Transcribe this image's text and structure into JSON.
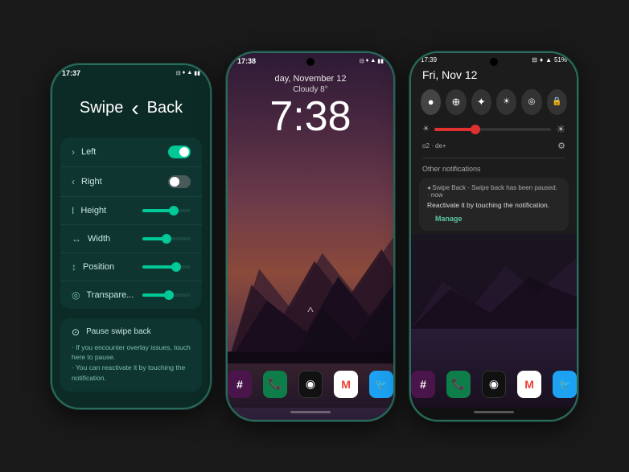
{
  "phone1": {
    "status_bar": {
      "time": "17:37",
      "icons": "⊟ ♦ ▲ ◀ ▮▮"
    },
    "header": {
      "swipe_label": "Swipe",
      "chevron": "‹",
      "back_label": "Back"
    },
    "settings": [
      {
        "icon": "›",
        "label": "Left",
        "control": "toggle_on"
      },
      {
        "icon": "‹",
        "label": "Right",
        "control": "toggle_off"
      },
      {
        "icon": "I",
        "label": "Height",
        "control": "slider",
        "fill": 65
      },
      {
        "icon": "↔",
        "label": "Width",
        "control": "slider",
        "fill": 50
      },
      {
        "icon": "↕",
        "label": "Position",
        "control": "slider",
        "fill": 70
      },
      {
        "icon": "◎",
        "label": "Transpare...",
        "control": "slider",
        "fill": 55
      }
    ],
    "pause_section": {
      "icon": "⊙",
      "label": "Pause swipe back",
      "note1": "· If you encounter overlay issues, touch",
      "note2": "here to pause.",
      "note3": "· You can reactivate it by touching the",
      "note4": "notification."
    }
  },
  "phone2": {
    "status_bar": {
      "time": "17:38",
      "icons": "⊟ ♦ ▲ ◀ ▮▮"
    },
    "date": "day, November 12",
    "weather": "Cloudy 8°",
    "time": "7:38",
    "dock_apps": [
      {
        "name": "Slack",
        "color": "#4a154b",
        "icon": "#"
      },
      {
        "name": "Phone",
        "color": "#0d7d4a",
        "icon": "📞"
      },
      {
        "name": "Camera",
        "color": "#111",
        "icon": "◉"
      },
      {
        "name": "Gmail",
        "color": "#fff",
        "icon": "M"
      },
      {
        "name": "Twitter",
        "color": "#1da1f2",
        "icon": "🐦"
      }
    ]
  },
  "phone3": {
    "status_bar": {
      "time": "17:39",
      "battery": "51%",
      "icons": "⊟ ♦ ▲ ▮"
    },
    "date": "Fri, Nov 12",
    "quick_toggles": [
      "●",
      "⊕",
      "✦",
      "☀",
      "◎",
      "🔒"
    ],
    "brightness": 35,
    "network": "o2 · de+",
    "other_notifications_label": "Other notifications",
    "notification": {
      "header": "◂ Swipe Back · Swipe back has been paused. · now",
      "text": "Reactivate it by touching the notification.",
      "manage_label": "Manage"
    },
    "dock_apps": [
      {
        "name": "Slack",
        "color": "#4a154b",
        "icon": "#"
      },
      {
        "name": "Phone",
        "color": "#0d7d4a",
        "icon": "📞"
      },
      {
        "name": "Camera",
        "color": "#111",
        "icon": "◉"
      },
      {
        "name": "Gmail",
        "color": "#fff",
        "icon": "M"
      },
      {
        "name": "Twitter",
        "color": "#1da1f2",
        "icon": "🐦"
      }
    ]
  }
}
